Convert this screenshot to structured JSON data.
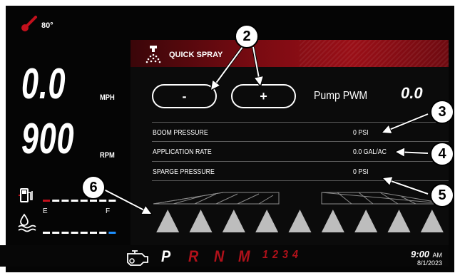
{
  "status": {
    "temperature": "80°"
  },
  "speed": {
    "value": "0.0",
    "unit": "MPH"
  },
  "engine": {
    "rpm_value": "900",
    "rpm_unit": "RPM"
  },
  "fuel": {
    "empty_label": "E",
    "full_label": "F",
    "level_fraction": 0.1
  },
  "def": {
    "level_fraction": 0.95
  },
  "quick_spray": {
    "title": "QUICK SPRAY",
    "minus_label": "-",
    "plus_label": "+",
    "pump_pwm_label": "Pump PWM",
    "pump_pwm_value": "0.0",
    "rows": [
      {
        "label": "BOOM PRESSURE",
        "value": "0 PSI"
      },
      {
        "label": "APPLICATION RATE",
        "value": "0.0 GAL/AC"
      },
      {
        "label": "SPARGE PRESSURE",
        "value": "0 PSI"
      }
    ],
    "nozzle_count": 9
  },
  "transmission": {
    "gears": [
      "P",
      "R",
      "N",
      "M",
      "1",
      "2",
      "3",
      "4"
    ],
    "active": "P"
  },
  "clock": {
    "time": "9:00",
    "ampm": "AM",
    "date": "8/1/2023"
  },
  "callouts": [
    "2",
    "3",
    "4",
    "5",
    "6"
  ],
  "colors": {
    "accent_red": "#c3101c",
    "def_blue": "#1e90ff"
  }
}
